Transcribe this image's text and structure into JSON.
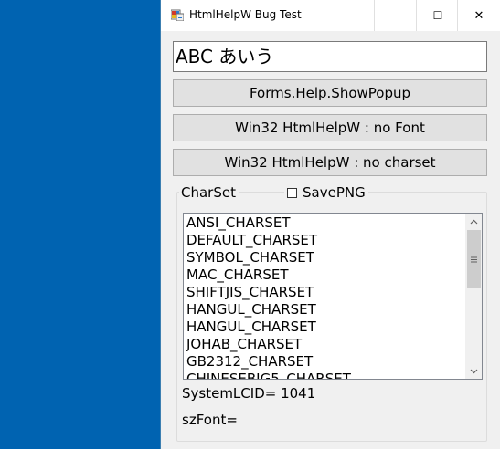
{
  "window": {
    "title": "HtmlHelpW Bug Test",
    "controls": {
      "minimize": "—",
      "maximize": "☐",
      "close": "✕"
    }
  },
  "textbox": {
    "value": "ABC あいう"
  },
  "buttons": {
    "show_popup": "Forms.Help.ShowPopup",
    "no_font": "Win32 HtmlHelpW : no Font",
    "no_charset": "Win32 HtmlHelpW : no charset"
  },
  "charset_group": {
    "label": "CharSet",
    "save_png_label": "SavePNG",
    "save_png_checked": false,
    "items": [
      "ANSI_CHARSET",
      "DEFAULT_CHARSET",
      "SYMBOL_CHARSET",
      "MAC_CHARSET",
      "SHIFTJIS_CHARSET",
      "HANGUL_CHARSET",
      "HANGUL_CHARSET",
      "JOHAB_CHARSET",
      "GB2312_CHARSET",
      "CHINESEBIG5_CHARSET"
    ],
    "lcid_label": "SystemLCID= 1041",
    "font_label": "szFont="
  },
  "icons": {
    "app": "app-icon",
    "scroll_up": "chevron-up-icon",
    "scroll_down": "chevron-down-icon"
  },
  "colors": {
    "desktop": "#0063b1",
    "window_bg": "#f0f0f0",
    "button_bg": "#e1e1e1"
  }
}
